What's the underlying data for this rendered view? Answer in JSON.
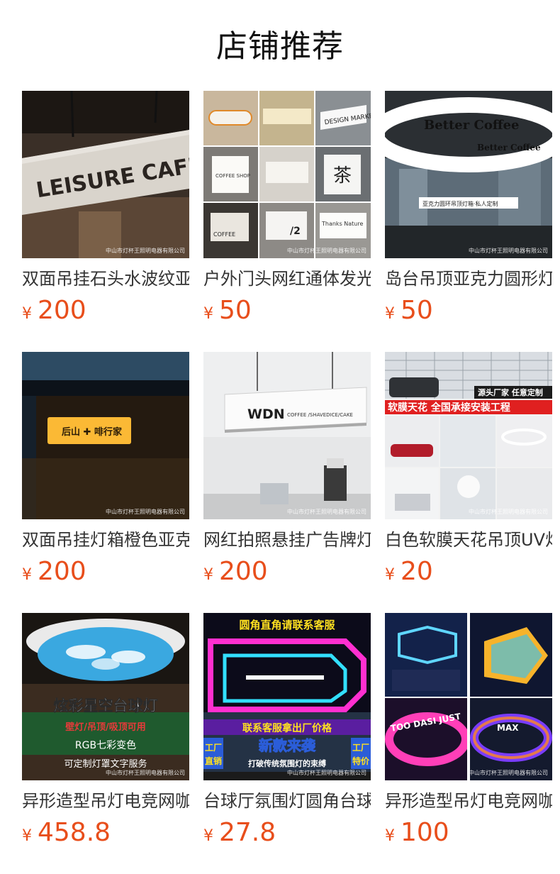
{
  "section": {
    "title": "店铺推荐"
  },
  "colors": {
    "price": "#e84e1b",
    "title": "#111111",
    "text": "#333333"
  },
  "watermark": "中山市灯杯王照明电器有限公司",
  "products": [
    {
      "name": "双面吊挂石头水波纹亚克力灯箱",
      "currency": "¥",
      "price": "200",
      "image_text": [
        "LEISURE CAFE"
      ]
    },
    {
      "name": "户外门头网红通体发光招牌灯箱",
      "currency": "¥",
      "price": "50",
      "image_text": [
        "COFFEE SHOP",
        "DESIGN MARKET",
        "茶",
        "Thanks Nature",
        "COFFEE",
        "/2"
      ]
    },
    {
      "name": "岛台吊顶亚克力圆形灯箱",
      "currency": "¥",
      "price": "50",
      "image_text": [
        "Better Coffee",
        "Better Coffee",
        "亚克力圆环吊顶灯箱·私人定制"
      ]
    },
    {
      "name": "双面吊挂灯箱橙色亚克力招牌",
      "currency": "¥",
      "price": "200",
      "image_text": [
        "后山 ✚ 啡行家"
      ]
    },
    {
      "name": "网红拍照悬挂广告牌灯箱",
      "currency": "¥",
      "price": "200",
      "image_text": [
        "WDN",
        "COFFEE /SHAVEDICE/CAKE"
      ]
    },
    {
      "name": "白色软膜天花吊顶UV灯膜",
      "currency": "¥",
      "price": "20",
      "image_text": [
        "源头厂家 任意定制",
        "软膜天花 全国承接安装工程"
      ]
    },
    {
      "name": "异形造型吊灯电竞网咖吊灯",
      "currency": "¥",
      "price": "458.8",
      "image_text": [
        "炫彩星空台球灯",
        "壁灯/吊顶/吸顶可用",
        "RGB七彩变色",
        "可定制灯罩文字服务"
      ]
    },
    {
      "name": "台球厅氛围灯圆角台球吊灯",
      "currency": "¥",
      "price": "27.8",
      "image_text": [
        "圆角直角请联系客服",
        "联系客服拿出厂价格",
        "新款来袭",
        "打破传统氛围灯的束缚",
        "工厂",
        "直销",
        "工厂",
        "特价"
      ]
    },
    {
      "name": "异形造型吊灯电竞网咖灯",
      "currency": "¥",
      "price": "100",
      "image_text": [
        "TOO DASI JUST",
        "MAX"
      ]
    }
  ]
}
